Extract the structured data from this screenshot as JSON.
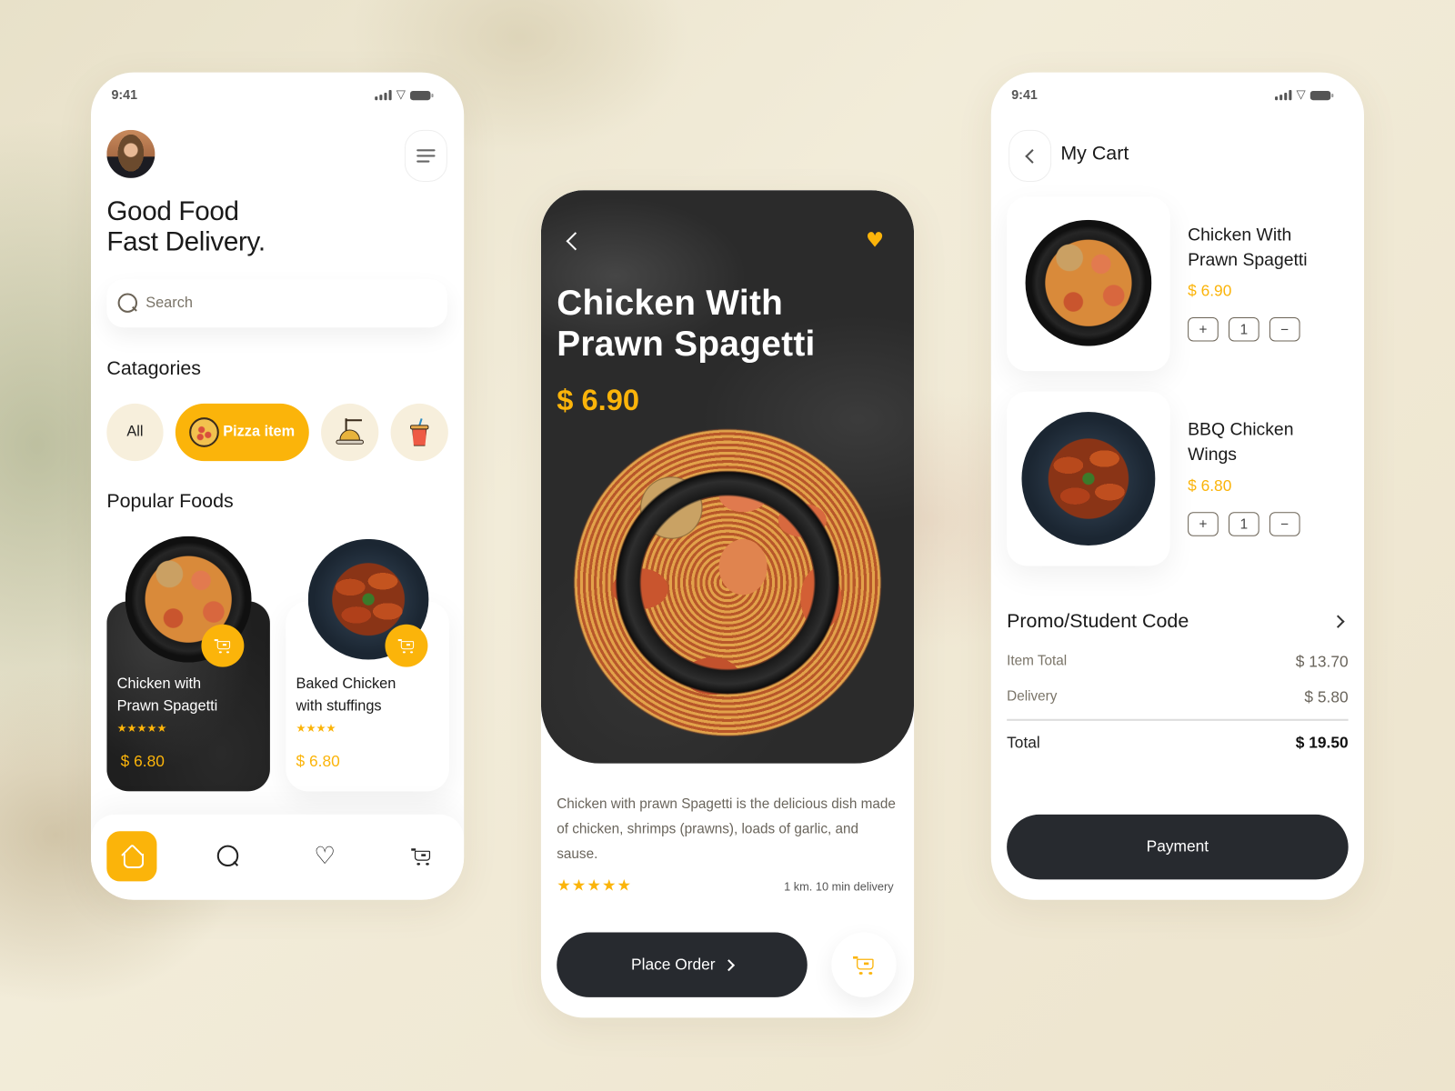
{
  "colors": {
    "accent": "#fbb40a",
    "dark": "#272a2f",
    "background": "#ece4cf"
  },
  "home_screen": {
    "status_time": "9:41",
    "headline_line1": "Good Food",
    "headline_line2": "Fast Delivery.",
    "search_placeholder": "Search",
    "categories_title": "Catagories",
    "categories": [
      {
        "label": "All",
        "icon": "none"
      },
      {
        "label": "Pizza item",
        "icon": "pizza-icon",
        "selected": true
      },
      {
        "label": "",
        "icon": "pasta-icon"
      },
      {
        "label": "",
        "icon": "drink-icon"
      }
    ],
    "popular_title": "Popular Foods",
    "popular_foods": [
      {
        "name_line1": "Chicken with",
        "name_line2": "Prawn Spagetti",
        "rating": 5,
        "stars": "★★★★★",
        "price": "$ 6.80"
      },
      {
        "name_line1": "Baked Chicken",
        "name_line2": "with stuffings",
        "rating": 4,
        "stars": "★★★★",
        "price": "$ 6.80"
      }
    ],
    "tabbar": [
      {
        "name": "home",
        "icon": "home-icon",
        "active": true
      },
      {
        "name": "search",
        "icon": "search-icon"
      },
      {
        "name": "favorites",
        "icon": "heart-icon"
      },
      {
        "name": "cart",
        "icon": "cart-icon"
      }
    ]
  },
  "detail_screen": {
    "title_line1": "Chicken With",
    "title_line2": "Prawn Spagetti",
    "price": "$ 6.90",
    "favorite_glyph": "♥",
    "description": "Chicken with prawn Spagetti is the delicious dish made of chicken, shrimps (prawns), loads of garlic, and sause.",
    "rating": 5,
    "stars": "★★★★★",
    "delivery_info": "1 km. 10 min delivery",
    "place_order_label": "Place Order"
  },
  "cart_screen": {
    "status_time": "9:41",
    "title": "My Cart",
    "items": [
      {
        "name_line1": "Chicken With",
        "name_line2": "Prawn Spagetti",
        "price": "$ 6.90",
        "quantity": "1",
        "plus": "+",
        "minus": "−"
      },
      {
        "name_line1": "BBQ Chicken",
        "name_line2": "Wings",
        "price": "$ 6.80",
        "quantity": "1",
        "plus": "+",
        "minus": "−"
      }
    ],
    "promo_label": "Promo/Student Code",
    "item_total_label": "Item Total",
    "item_total_value": "$ 13.70",
    "delivery_label": "Delivery",
    "delivery_value": "$ 5.80",
    "total_label": "Total",
    "total_value": "$ 19.50",
    "payment_label": "Payment"
  },
  "heart_outline_glyph": "♡"
}
